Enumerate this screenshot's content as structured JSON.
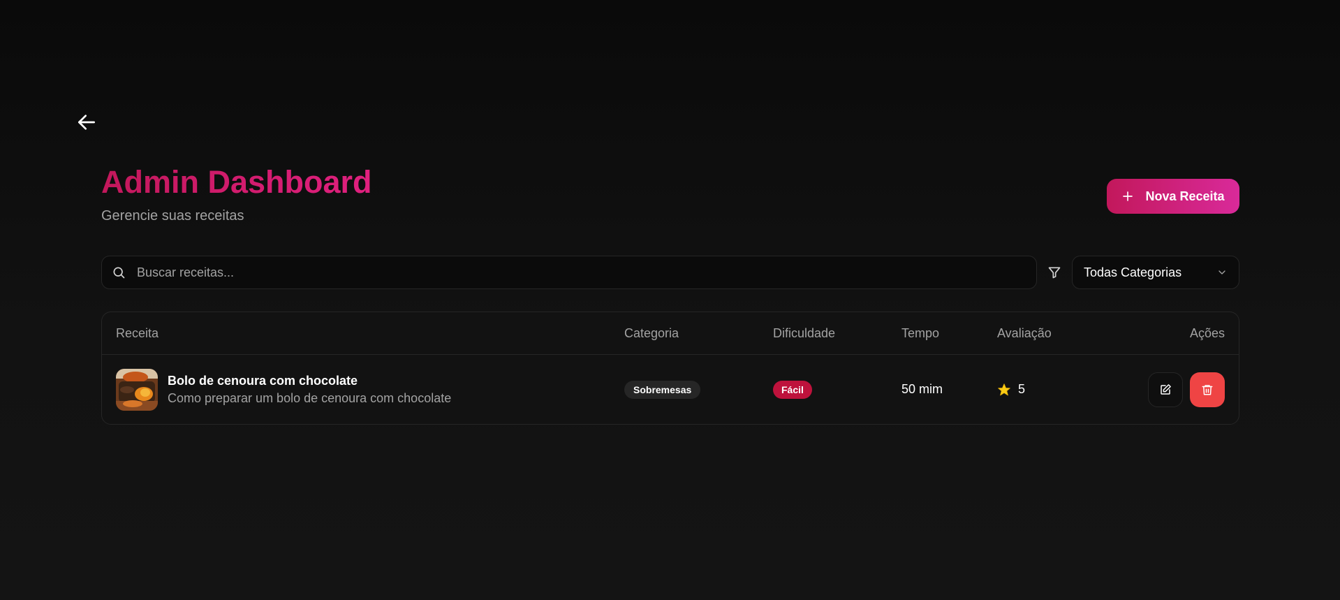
{
  "header": {
    "title": "Admin Dashboard",
    "subtitle": "Gerencie suas receitas",
    "new_button_label": "Nova Receita"
  },
  "filters": {
    "search_placeholder": "Buscar receitas...",
    "search_value": "",
    "category_selected": "Todas Categorias"
  },
  "table": {
    "columns": [
      "Receita",
      "Categoria",
      "Dificuldade",
      "Tempo",
      "Avaliação",
      "Ações"
    ],
    "rows": [
      {
        "name": "Bolo de cenoura com chocolate",
        "description": "Como preparar um bolo de cenoura com chocolate",
        "category": "Sobremesas",
        "difficulty": "Fácil",
        "time": "50 mim",
        "rating": "5"
      }
    ]
  },
  "colors": {
    "accent": "#c2185b",
    "accent_end": "#d92a9a",
    "danger": "#ef4444",
    "star": "#facc15",
    "difficulty_easy": "#be123c"
  },
  "icons": {
    "back": "arrow-left-icon",
    "add": "plus-icon",
    "search": "search-icon",
    "filter": "filter-icon",
    "dropdown": "chevron-down-icon",
    "rating": "star-icon",
    "edit": "edit-icon",
    "delete": "trash-icon"
  }
}
